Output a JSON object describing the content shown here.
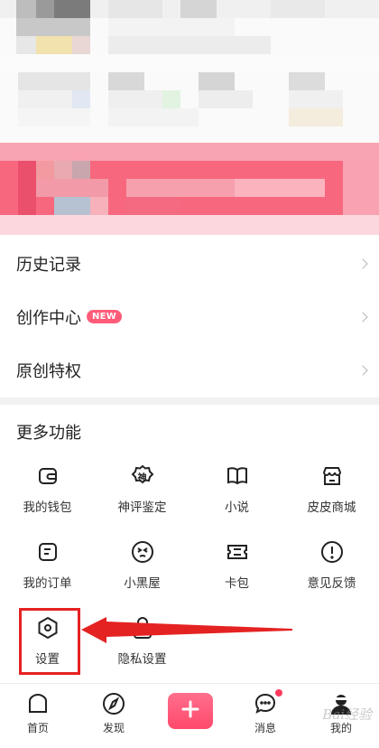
{
  "menu": {
    "items": [
      {
        "label": "历史记录"
      },
      {
        "label": "创作中心",
        "badge": "NEW"
      },
      {
        "label": "原创特权"
      }
    ]
  },
  "more": {
    "title": "更多功能",
    "items": [
      {
        "label": "我的钱包",
        "icon": "wallet-icon"
      },
      {
        "label": "神评鉴定",
        "icon": "shen-badge-icon",
        "glyph": "神"
      },
      {
        "label": "小说",
        "icon": "book-icon"
      },
      {
        "label": "皮皮商城",
        "icon": "shop-icon"
      },
      {
        "label": "我的订单",
        "icon": "order-icon"
      },
      {
        "label": "小黑屋",
        "icon": "sad-face-icon"
      },
      {
        "label": "卡包",
        "icon": "card-icon"
      },
      {
        "label": "意见反馈",
        "icon": "feedback-icon"
      },
      {
        "label": "设置",
        "icon": "settings-icon"
      },
      {
        "label": "隐私设置",
        "icon": "lock-icon"
      }
    ]
  },
  "tabbar": {
    "items": [
      {
        "label": "首页",
        "icon": "home-icon"
      },
      {
        "label": "发现",
        "icon": "compass-icon"
      },
      {
        "label": "",
        "icon": "plus-icon"
      },
      {
        "label": "消息",
        "icon": "chat-icon"
      },
      {
        "label": "我的",
        "icon": "profile-icon"
      }
    ]
  },
  "watermark": "Bai经验",
  "colors": {
    "accent": "#ff5c7a",
    "highlight": "#e52222",
    "banner_pink": "#f7687f"
  }
}
